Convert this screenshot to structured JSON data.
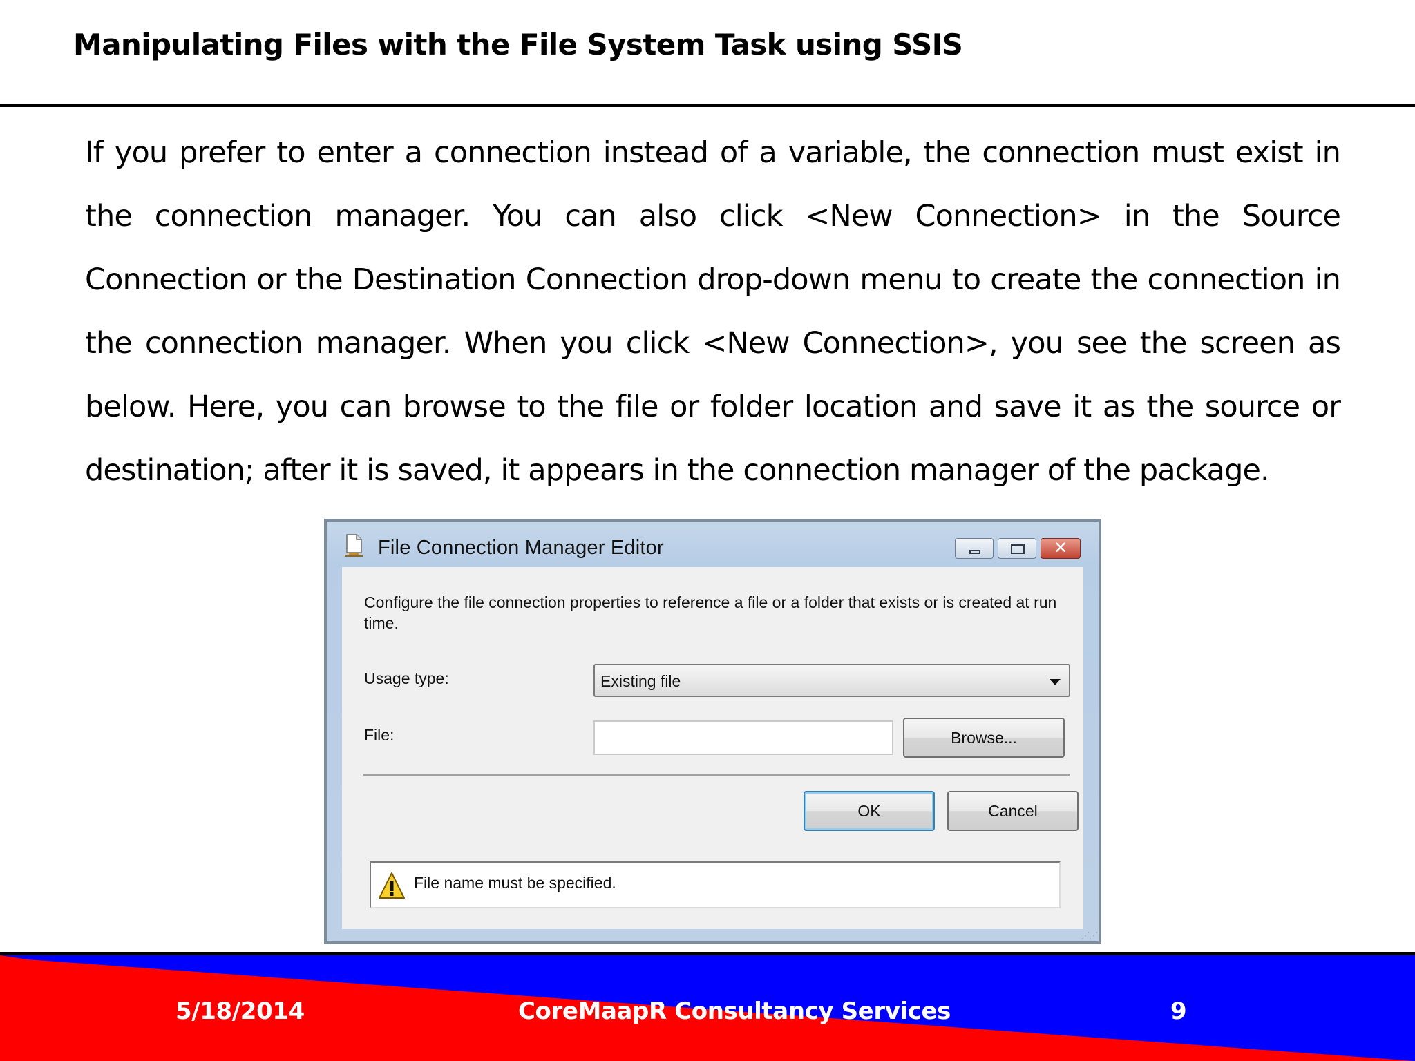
{
  "slide": {
    "title": "Manipulating Files with the File System Task using SSIS",
    "body": "If you prefer to enter a connection instead of a variable, the connection must exist in the connection manager. You can also click <New Connection> in the Source Connection or the Destination Connection drop-down menu to create the connection in the connection manager. When you click <New Connection>, you see the screen as below. Here, you can browse to the file or folder location and save it as the source or destination; after it is saved, it appears in the connection manager of the package."
  },
  "dialog": {
    "title": "File Connection Manager Editor",
    "icon": "file-connection-icon",
    "window_buttons": {
      "minimize": "minimize",
      "maximize": "maximize",
      "close": "close"
    },
    "description": "Configure the file connection properties to reference a file or a folder that exists or is created at run time.",
    "usage_type_label": "Usage type:",
    "usage_type_value": "Existing file",
    "file_label": "File:",
    "file_value": "",
    "browse_label": "Browse...",
    "ok_label": "OK",
    "cancel_label": "Cancel",
    "status_message": "File name must be specified.",
    "status_icon": "warning-icon"
  },
  "footer": {
    "date": "5/18/2014",
    "company": "CoreMaapR Consultancy Services",
    "page": "9",
    "colors": {
      "red": "#ff0000",
      "blue": "#0000ff"
    }
  }
}
